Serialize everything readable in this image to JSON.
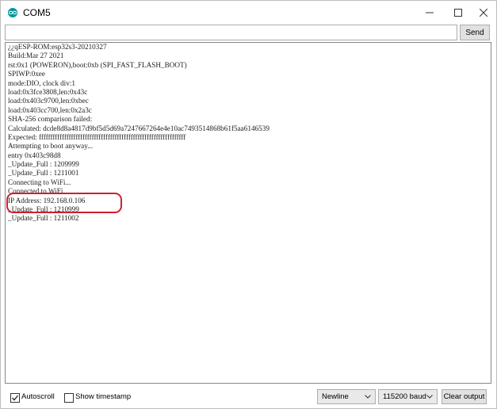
{
  "window": {
    "title": "COM5",
    "app_icon": "arduino-icon",
    "controls": [
      "minimize-icon",
      "maximize-icon",
      "close-icon"
    ]
  },
  "send": {
    "input_value": "",
    "button_label": "Send"
  },
  "output": {
    "lines": [
      "¿¿qESP-ROM:esp32s3-20210327",
      "Build:Mar 27 2021",
      "rst:0x1 (POWERON),boot:0xb (SPI_FAST_FLASH_BOOT)",
      "SPIWP:0xee",
      "mode:DIO, clock div:1",
      "load:0x3fce3808,len:0x43c",
      "load:0x403c9700,len:0xbec",
      "load:0x403cc700,len:0x2a3c",
      "SHA-256 comparison failed:",
      "Calculated: dcde8d8a4817d9bf5d5d69a7247667264e4e10ac7493514868b61f5aa6146539",
      "Expected: ffffffffffffffffffffffffffffffffffffffffffffffffffffffffffffffff",
      "Attempting to boot anyway...",
      "entry 0x403c98d8",
      "_Update_Full : 1209999",
      "_Update_Full : 1211001",
      "Connecting to WiFi...",
      "Connected to WiFi",
      "IP Address: 192.168.0.106",
      "_Update_Full : 1210999",
      "_Update_Full : 1211002"
    ],
    "highlight_color": "#cf1f2f"
  },
  "footer": {
    "autoscroll_label": "Autoscroll",
    "autoscroll_checked": true,
    "timestamp_label": "Show timestamp",
    "timestamp_checked": false,
    "line_ending": "Newline",
    "baud_rate": "115200 baud",
    "clear_label": "Clear output"
  },
  "colors": {
    "arduino_teal": "#00979d",
    "button_face": "#e1e1e1"
  }
}
